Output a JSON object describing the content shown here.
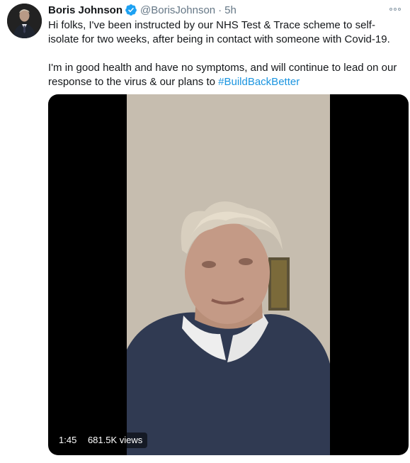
{
  "tweet": {
    "author": {
      "display_name": "Boris Johnson",
      "handle": "@BorisJohnson",
      "separator": "·",
      "timestamp": "5h",
      "verified_icon": "verified-badge-icon"
    },
    "more_icon": "more-options-icon",
    "text_paragraph_1": "Hi folks, I've been instructed by our NHS Test & Trace scheme to self-isolate for two weeks, after being in contact with someone with Covid-19.",
    "text_paragraph_2_prefix": "I'm in good health and have no symptoms, and will continue to lead on our response to the virus & our plans to ",
    "hashtag": "#BuildBackBetter",
    "video": {
      "duration": "1:45",
      "views": "681.5K views"
    }
  },
  "colors": {
    "text_primary": "#14171a",
    "text_secondary": "#657786",
    "link": "#1b95e0",
    "verified": "#1da1f2",
    "video_letterbox": "#000000"
  }
}
